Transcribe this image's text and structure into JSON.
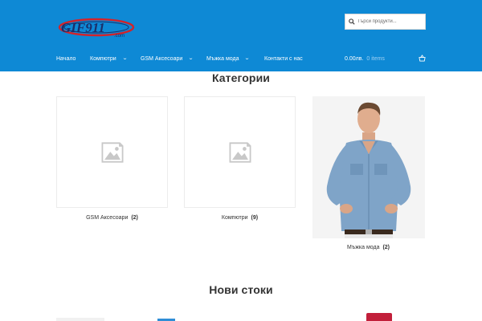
{
  "brand": {
    "logo_text": "GIF911",
    "logo_subtext": ".com"
  },
  "search": {
    "placeholder": "Търси продукти..."
  },
  "nav": {
    "items": [
      {
        "label": "Начало",
        "has_dropdown": false
      },
      {
        "label": "Компютри",
        "has_dropdown": true
      },
      {
        "label": "GSM Аксесоари",
        "has_dropdown": true
      },
      {
        "label": "Мъжка мода",
        "has_dropdown": true
      },
      {
        "label": "Контакти с нас",
        "has_dropdown": false
      }
    ]
  },
  "cart": {
    "total": "0.00лв.",
    "items": "0 items"
  },
  "categories": {
    "title": "Категории",
    "cards": [
      {
        "name": "GSM Аксесоари",
        "count": "(2)",
        "image": "placeholder-image-icon"
      },
      {
        "name": "Компютри",
        "count": "(9)",
        "image": "placeholder-image-icon"
      },
      {
        "name": "Мъжка мода",
        "count": "(2)",
        "image": "man-in-denim-shirt-photo"
      }
    ]
  },
  "new_products": {
    "title": "Нови стоки"
  },
  "colors": {
    "header": "#0e89d5",
    "text": "#333333",
    "placeholder_border": "#ececec",
    "placeholder_icon": "#c8c8c8"
  }
}
